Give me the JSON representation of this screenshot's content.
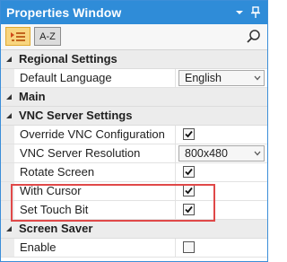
{
  "window": {
    "title": "Properties Window"
  },
  "toolbar": {
    "categorized_label": "",
    "alphabetical_label": "A-Z"
  },
  "grid": {
    "sections": [
      {
        "name": "Regional Settings",
        "properties": [
          {
            "name": "Default Language",
            "type": "dropdown",
            "value": "English"
          }
        ]
      },
      {
        "name": "Main",
        "properties": []
      },
      {
        "name": "VNC Server Settings",
        "properties": [
          {
            "name": "Override VNC Configuration",
            "type": "checkbox",
            "checked": true
          },
          {
            "name": "VNC Server Resolution",
            "type": "dropdown",
            "value": "800x480"
          },
          {
            "name": "Rotate Screen",
            "type": "checkbox",
            "checked": true
          },
          {
            "name": "With Cursor",
            "type": "checkbox",
            "checked": true
          },
          {
            "name": "Set Touch Bit",
            "type": "checkbox",
            "checked": true
          }
        ]
      },
      {
        "name": "Screen Saver",
        "properties": [
          {
            "name": "Enable",
            "type": "checkbox",
            "checked": false
          }
        ]
      }
    ]
  },
  "colors": {
    "title_bar": "#2f8cd8",
    "highlight_box": "#e04848",
    "active_tool": "#f8d57f"
  }
}
